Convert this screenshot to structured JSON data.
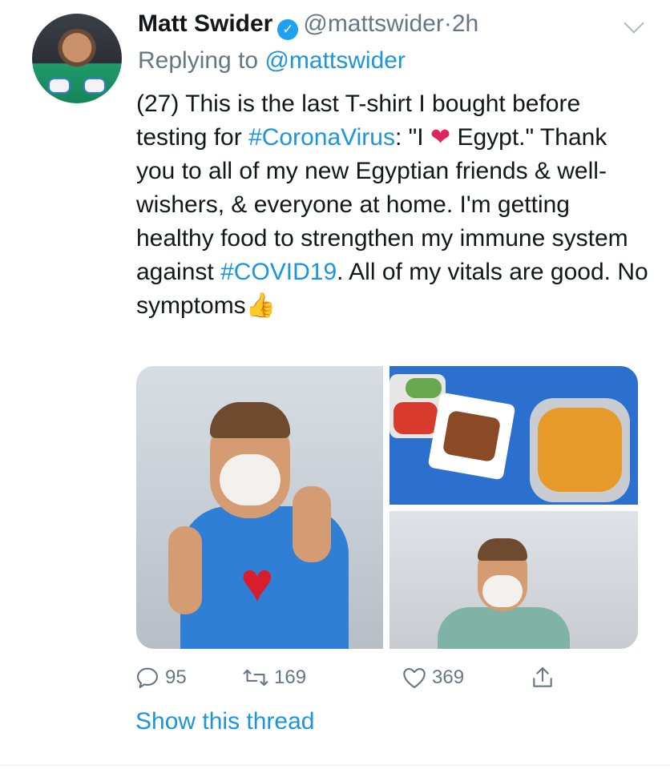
{
  "tweet": {
    "author_name": "Matt Swider",
    "handle": "@mattswider",
    "separator": "·",
    "time": "2h",
    "replying_prefix": "Replying to",
    "replying_to": "@mattswider",
    "text": {
      "t1": "(27) This is the last T-shirt I bought before testing for ",
      "tag1": "#CoronaVirus",
      "t2": ": \"I ",
      "heart": "❤",
      "t3": " Egypt.\" Thank you to all of my new Egyptian friends & well-wishers, & everyone at home. I'm getting healthy food to strengthen my immune system against ",
      "tag2": "#COVID19",
      "t4": ". All of my vitals are good. No symptoms",
      "thumb": "👍"
    },
    "stats": {
      "replies": "95",
      "retweets": "169",
      "likes": "369"
    },
    "show_thread": "Show this thread"
  },
  "icons": {
    "verified": "verified-badge-icon",
    "more": "chevron-down-icon",
    "reply": "reply-icon",
    "retweet": "retweet-icon",
    "like": "heart-icon",
    "share": "share-icon"
  },
  "colors": {
    "link": "#1b95e0",
    "secondary": "#657786",
    "primary_text": "#14171a"
  }
}
